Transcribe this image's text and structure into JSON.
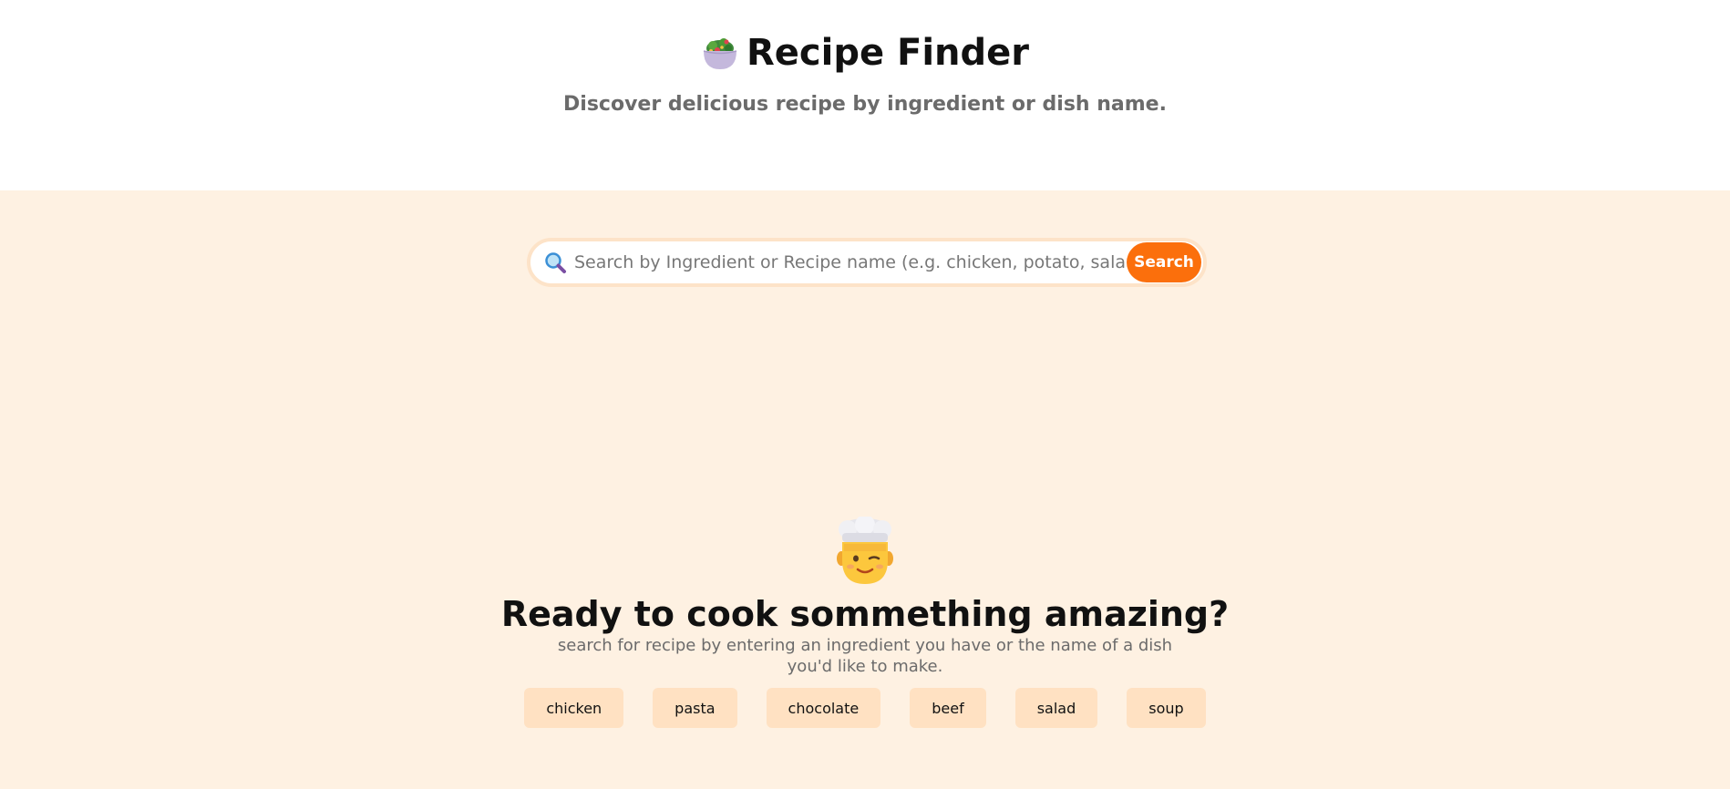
{
  "header": {
    "title": "Recipe Finder",
    "subtitle": "Discover delicious recipe by ingredient or dish name."
  },
  "search": {
    "placeholder": "Search by Ingredient or Recipe name (e.g. chicken, potato, salad)",
    "button_label": "Search"
  },
  "empty_state": {
    "heading": "Ready to cook sommething amazing?",
    "description": "search for recipe by entering an ingredient you have or the name of a dish you'd like to make."
  },
  "suggestions": [
    "chicken",
    "pasta",
    "chocolate",
    "beef",
    "salad",
    "soup"
  ],
  "colors": {
    "accent": "#fb6f0c",
    "background": "#fef1e2",
    "chip": "#ffe1c2"
  },
  "icons": {
    "title": "salad-bowl-icon",
    "search": "magnifier-icon",
    "empty_state": "chef-icon"
  }
}
